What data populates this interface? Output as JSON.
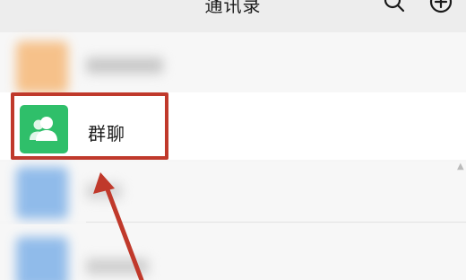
{
  "header": {
    "title": "通讯录"
  },
  "group_chat": {
    "label": "群聊",
    "avatar_color": "#2fbf6a",
    "icon": "group-people-icon"
  },
  "highlight": {
    "color": "#c0392b"
  },
  "blurred_contacts": [
    {
      "avatar_color": "#f6b877"
    },
    {
      "avatar_color": "#7fb1e8"
    },
    {
      "avatar_color": "#7fb1e8"
    }
  ]
}
